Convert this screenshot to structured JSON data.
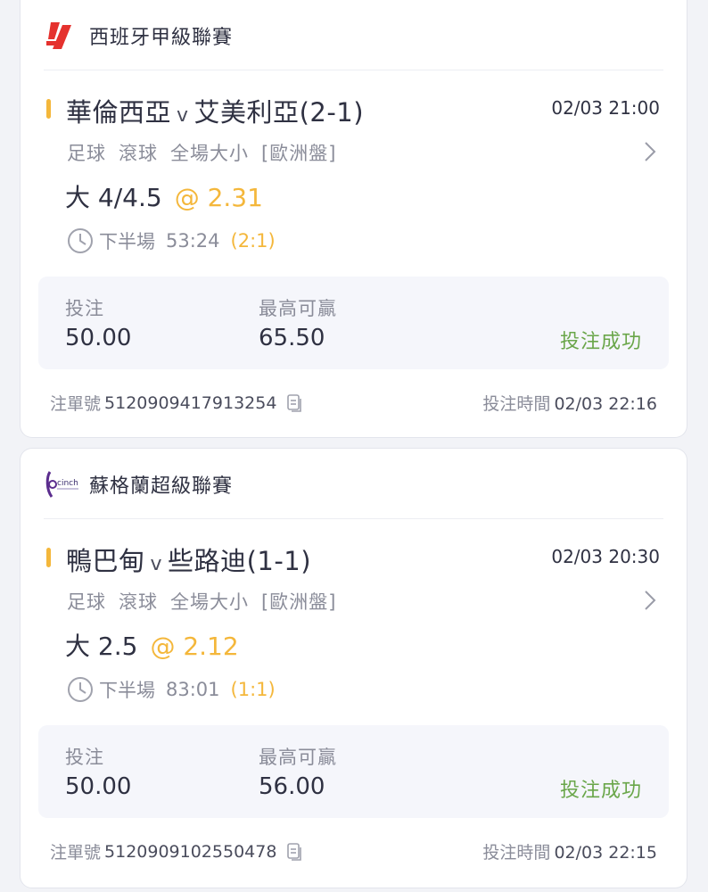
{
  "colors": {
    "accent": "#f4b73b",
    "success": "#6aa64a",
    "muted": "#8a8c99",
    "text": "#2f3142",
    "stake_bg": "#f5f6fb"
  },
  "bets": [
    {
      "league": {
        "name": "西班牙甲級聯賽",
        "logo_icon": "laliga-logo-icon"
      },
      "match": {
        "home": "華倫西亞",
        "vs": "v",
        "away": "艾美利亞",
        "score_suffix": "(2-1)",
        "kickoff": "02/03 21:00"
      },
      "market": {
        "sport": "足球",
        "mode": "滾球",
        "type": "全場大小",
        "odds_format": "[歐洲盤]"
      },
      "selection": {
        "pick": "大 4/4.5",
        "odds": "@ 2.31"
      },
      "status": {
        "period": "下半場",
        "clock": "53:24",
        "score": "(2:1)"
      },
      "stake": {
        "label": "投注",
        "value": "50.00"
      },
      "max_win": {
        "label": "最高可贏",
        "value": "65.50"
      },
      "result": "投注成功",
      "footer": {
        "slip_label": "注單號",
        "slip_no": "5120909417913254",
        "time_label": "投注時間",
        "time": "02/03 22:16"
      }
    },
    {
      "league": {
        "name": "蘇格蘭超級聯賽",
        "logo_icon": "cinch-premiership-logo-icon"
      },
      "match": {
        "home": "鴨巴甸",
        "vs": "v",
        "away": "些路迪",
        "score_suffix": "(1-1)",
        "kickoff": "02/03 20:30"
      },
      "market": {
        "sport": "足球",
        "mode": "滾球",
        "type": "全場大小",
        "odds_format": "[歐洲盤]"
      },
      "selection": {
        "pick": "大 2.5",
        "odds": "@ 2.12"
      },
      "status": {
        "period": "下半場",
        "clock": "83:01",
        "score": "(1:1)"
      },
      "stake": {
        "label": "投注",
        "value": "50.00"
      },
      "max_win": {
        "label": "最高可贏",
        "value": "56.00"
      },
      "result": "投注成功",
      "footer": {
        "slip_label": "注單號",
        "slip_no": "5120909102550478",
        "time_label": "投注時間",
        "time": "02/03 22:15"
      }
    }
  ]
}
